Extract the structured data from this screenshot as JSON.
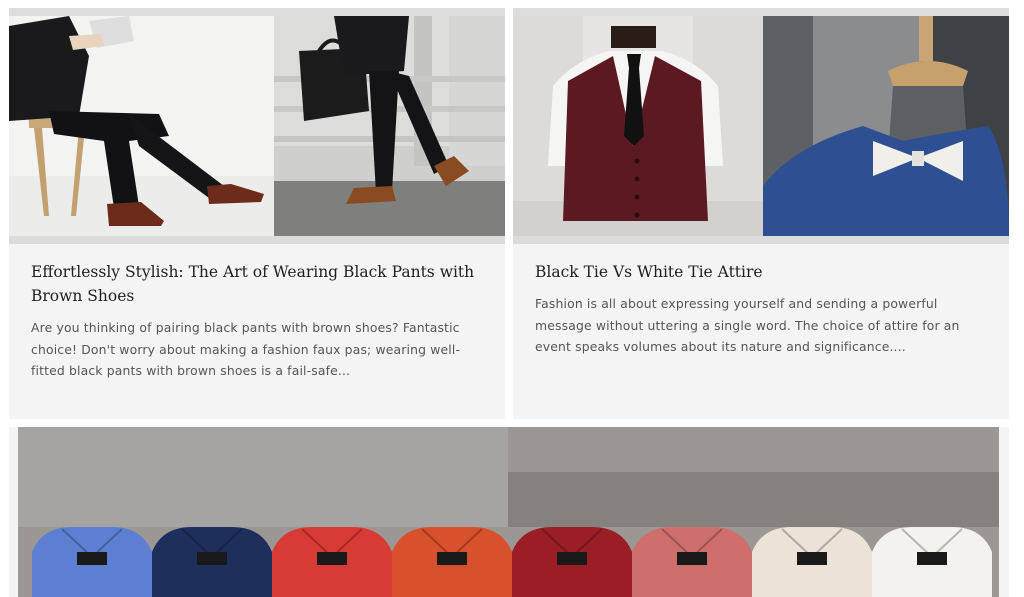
{
  "cards": [
    {
      "title": "Effortlessly Stylish: The Art of Wearing Black Pants with Brown Shoes",
      "excerpt": "Are you thinking of pairing black pants with brown shoes? Fantastic choice! Don't worry about making a fashion faux pas; wearing well-fitted black pants with brown shoes is a fail-safe...",
      "image_left": "man-seated-black-pants-brown-shoes-photo",
      "image_right": "man-walking-black-pants-brown-shoes-photo"
    },
    {
      "title": "Black Tie Vs White Tie Attire",
      "excerpt": "Fashion is all about expressing yourself and sending a powerful message without uttering a single word. The choice of attire for an event speaks volumes about its nature and significance....",
      "image_left": "mannequin-burgundy-vest-black-tie-photo",
      "image_right": "mannequin-blue-shirt-white-bow-tie-photo"
    },
    {
      "image": "folded-dress-shirts-row-photo",
      "shirt_colors": [
        "#5c7fd1",
        "#1f2f5c",
        "#d83a35",
        "#d9502c",
        "#9c1e25",
        "#cf6f6c",
        "#ece2d7",
        "#f4f2ef"
      ]
    }
  ]
}
